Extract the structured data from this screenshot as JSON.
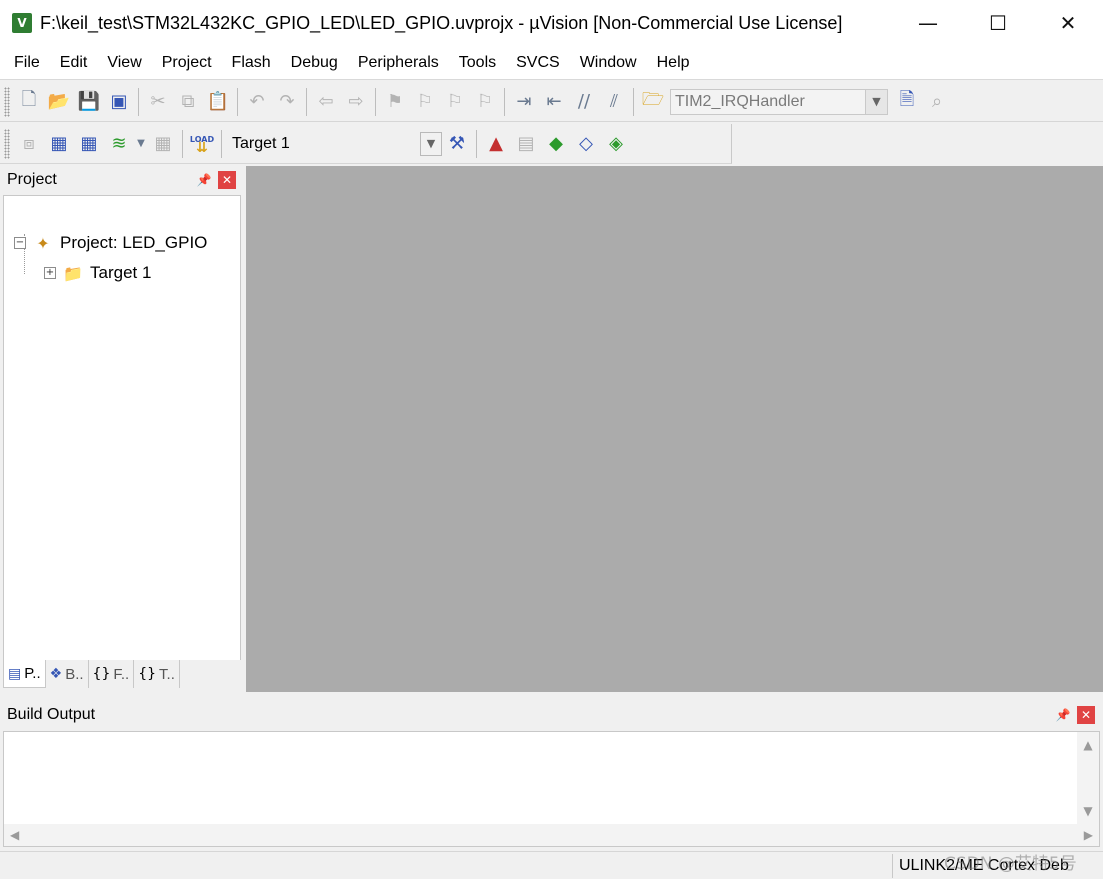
{
  "window": {
    "title": "F:\\keil_test\\STM32L432KC_GPIO_LED\\LED_GPIO.uvprojx - µVision  [Non-Commercial Use License]",
    "minimize_glyph": "—",
    "maximize_glyph": "☐",
    "close_glyph": "✕"
  },
  "menu": [
    "File",
    "Edit",
    "View",
    "Project",
    "Flash",
    "Debug",
    "Peripherals",
    "Tools",
    "SVCS",
    "Window",
    "Help"
  ],
  "toolbar1": {
    "function_combo": "TIM2_IRQHandler"
  },
  "toolbar2": {
    "load_label": "LOAD",
    "target_combo": "Target 1"
  },
  "project_panel": {
    "title": "Project",
    "tree": {
      "root_expander": "−",
      "root_label": "Project: LED_GPIO",
      "child_expander": "+",
      "child_label": "Target 1"
    },
    "tabs": [
      "P..",
      "B..",
      "F..",
      "T.."
    ]
  },
  "build_output": {
    "title": "Build Output",
    "content": ""
  },
  "status_bar": {
    "debugger": "ULINK2/ME Cortex Deb"
  },
  "watermark": "CSDN @艾特5号",
  "colors": {
    "editor_background": "#ababab",
    "panel_close": "#e04343",
    "app_logo": "#2f7d32"
  }
}
